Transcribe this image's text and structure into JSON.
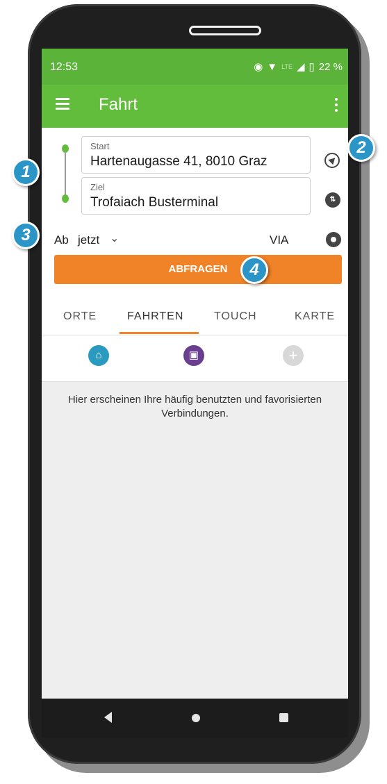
{
  "status_bar": {
    "time": "12:53",
    "network": "LTE",
    "battery": "22 %"
  },
  "app_bar": {
    "title": "Fahrt"
  },
  "form": {
    "start_label": "Start",
    "start_value": "Hartenaugasse 41, 8010 Graz",
    "start_pin": "A",
    "dest_label": "Ziel",
    "dest_value": "Trofaiach Busterminal",
    "dest_pin": "B",
    "time_prefix": "Ab",
    "time_value": "jetzt",
    "via_label": "VIA",
    "query_button": "ABFRAGEN"
  },
  "tabs": [
    {
      "label": "ORTE"
    },
    {
      "label": "FAHRTEN",
      "active": true
    },
    {
      "label": "TOUCH"
    },
    {
      "label": "KARTE"
    }
  ],
  "quick_icons": [
    {
      "name": "home-icon",
      "color": "#2a9bbf"
    },
    {
      "name": "briefcase-icon",
      "color": "#6a3f8f"
    },
    {
      "name": "add-icon",
      "color": "#d8d8d8"
    }
  ],
  "empty_message": "Hier erscheinen Ihre häufig benutzten und favorisierten Verbindungen.",
  "callouts": [
    "1",
    "2",
    "3",
    "4"
  ],
  "colors": {
    "status_green": "#5cb33a",
    "appbar_green": "#62bd3c",
    "accent_orange": "#f08227",
    "callout_blue": "#2a95c6"
  }
}
